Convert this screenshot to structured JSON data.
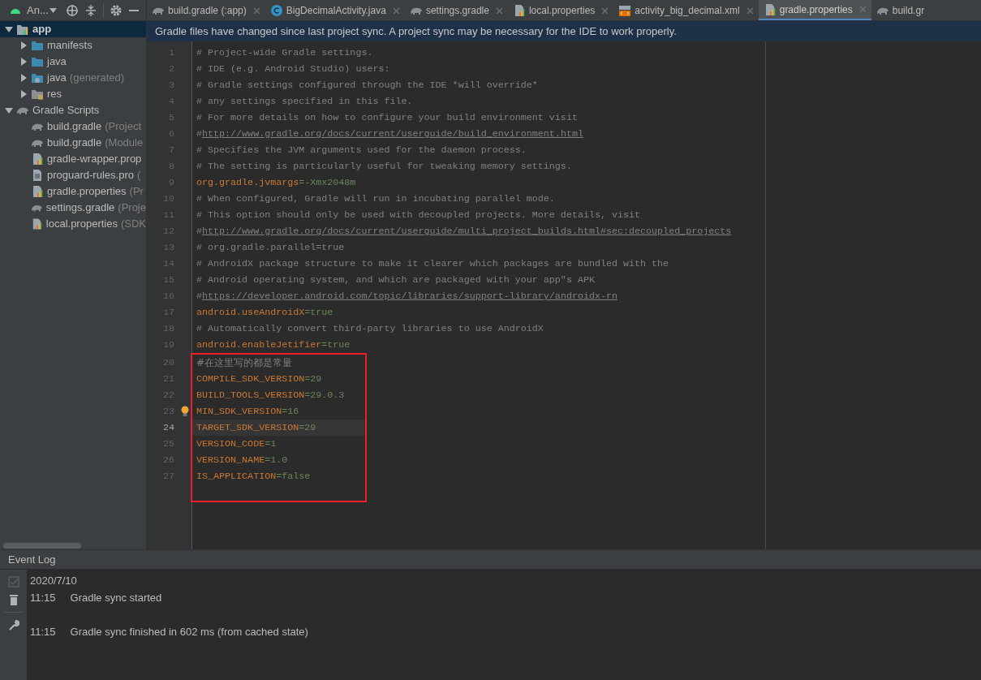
{
  "toolbar": {
    "project_view": "An..."
  },
  "tabs": [
    {
      "label": "build.gradle (:app)",
      "kind": "gradle",
      "selected": false,
      "closable": true
    },
    {
      "label": "BigDecimalActivity.java",
      "kind": "class",
      "selected": false,
      "closable": true
    },
    {
      "label": "settings.gradle",
      "kind": "gradle",
      "selected": false,
      "closable": true
    },
    {
      "label": "local.properties",
      "kind": "properties",
      "selected": false,
      "closable": true
    },
    {
      "label": "activity_big_decimal.xml",
      "kind": "xml",
      "selected": false,
      "closable": true
    },
    {
      "label": "gradle.properties",
      "kind": "properties",
      "selected": true,
      "closable": true
    },
    {
      "label": "build.gr",
      "kind": "gradle",
      "selected": false,
      "closable": false
    }
  ],
  "project_tree": [
    {
      "label": "app",
      "kind": "module",
      "expanded": true,
      "selected": true,
      "children": [
        {
          "label": "manifests",
          "kind": "folder",
          "expanded": false,
          "selected": false
        },
        {
          "label": "java",
          "kind": "folder",
          "expanded": false,
          "selected": false
        },
        {
          "label": "java",
          "note": "(generated)",
          "kind": "generated",
          "expanded": false,
          "selected": false
        },
        {
          "label": "res",
          "kind": "resources",
          "expanded": false,
          "selected": false
        }
      ]
    },
    {
      "label": "Gradle Scripts",
      "kind": "gradle",
      "expanded": true,
      "selected": false,
      "children": [
        {
          "label": "build.gradle",
          "note": "(Project",
          "kind": "gradle",
          "selected": false
        },
        {
          "label": "build.gradle",
          "note": "(Module",
          "kind": "gradle",
          "selected": false
        },
        {
          "label": "gradle-wrapper.prop",
          "kind": "properties",
          "selected": false
        },
        {
          "label": "proguard-rules.pro",
          "note": "(",
          "kind": "text",
          "selected": false
        },
        {
          "label": "gradle.properties",
          "note": "(Pr",
          "kind": "properties",
          "selected": false
        },
        {
          "label": "settings.gradle",
          "note": "(Proje",
          "kind": "gradle",
          "selected": false
        },
        {
          "label": "local.properties",
          "note": "(SDK",
          "kind": "properties",
          "selected": false
        }
      ]
    }
  ],
  "notification": "Gradle files have changed since last project sync. A project sync may be necessary for the IDE to work properly.",
  "editor": {
    "lines": [
      {
        "number": "1",
        "current": false,
        "parts": [
          {
            "kind": "comment",
            "text": "# Project-wide Gradle settings."
          }
        ]
      },
      {
        "number": "2",
        "current": false,
        "parts": [
          {
            "kind": "comment",
            "text": "# IDE (e.g. Android Studio) users:"
          }
        ]
      },
      {
        "number": "3",
        "current": false,
        "parts": [
          {
            "kind": "comment",
            "text": "# Gradle settings configured through the IDE *will override*"
          }
        ]
      },
      {
        "number": "4",
        "current": false,
        "parts": [
          {
            "kind": "comment",
            "text": "# any settings specified in this file."
          }
        ]
      },
      {
        "number": "5",
        "current": false,
        "parts": [
          {
            "kind": "comment",
            "text": "# For more details on how to configure your build environment visit"
          }
        ]
      },
      {
        "number": "6",
        "current": false,
        "parts": [
          {
            "kind": "comment",
            "text": "# "
          },
          {
            "kind": "link",
            "text": "http://www.gradle.org/docs/current/userguide/build_environment.html"
          }
        ]
      },
      {
        "number": "7",
        "current": false,
        "parts": [
          {
            "kind": "comment",
            "text": "# Specifies the JVM arguments used for the daemon process."
          }
        ]
      },
      {
        "number": "8",
        "current": false,
        "parts": [
          {
            "kind": "comment",
            "text": "# The setting is particularly useful for tweaking memory settings."
          }
        ]
      },
      {
        "number": "9",
        "current": false,
        "parts": [
          {
            "kind": "key",
            "text": "org.gradle.jvmargs"
          },
          {
            "kind": "value",
            "text": "=-Xmx2048m"
          }
        ]
      },
      {
        "number": "10",
        "current": false,
        "parts": [
          {
            "kind": "comment",
            "text": "# When configured, Gradle will run in incubating parallel mode."
          }
        ]
      },
      {
        "number": "11",
        "current": false,
        "parts": [
          {
            "kind": "comment",
            "text": "# This option should only be used with decoupled projects. More details, visit"
          }
        ]
      },
      {
        "number": "12",
        "current": false,
        "parts": [
          {
            "kind": "comment",
            "text": "# "
          },
          {
            "kind": "link",
            "text": "http://www.gradle.org/docs/current/userguide/multi_project_builds.html#sec:decoupled_projects"
          }
        ]
      },
      {
        "number": "13",
        "current": false,
        "parts": [
          {
            "kind": "comment",
            "text": "# org.gradle.parallel=true"
          }
        ]
      },
      {
        "number": "14",
        "current": false,
        "parts": [
          {
            "kind": "comment",
            "text": "# AndroidX package structure to make it clearer which packages are bundled with the"
          }
        ]
      },
      {
        "number": "15",
        "current": false,
        "parts": [
          {
            "kind": "comment",
            "text": "# Android operating system, and which are packaged with your app\"s APK"
          }
        ]
      },
      {
        "number": "16",
        "current": false,
        "parts": [
          {
            "kind": "comment",
            "text": "# "
          },
          {
            "kind": "link",
            "text": "https://developer.android.com/topic/libraries/support-library/androidx-rn"
          }
        ]
      },
      {
        "number": "17",
        "current": false,
        "parts": [
          {
            "kind": "key",
            "text": "android.useAndroidX"
          },
          {
            "kind": "value",
            "text": "=true"
          }
        ]
      },
      {
        "number": "18",
        "current": false,
        "parts": [
          {
            "kind": "comment",
            "text": "# Automatically convert third-party libraries to use AndroidX"
          }
        ]
      },
      {
        "number": "19",
        "current": false,
        "parts": [
          {
            "kind": "key",
            "text": "android.enableJetifier"
          },
          {
            "kind": "value",
            "text": "=true"
          }
        ]
      }
    ],
    "framed_lines": [
      {
        "number": "20",
        "current": false,
        "parts": [
          {
            "kind": "comment",
            "text": "#在这里写的都是常量"
          }
        ]
      },
      {
        "number": "21",
        "current": false,
        "parts": [
          {
            "kind": "key",
            "text": "COMPILE_SDK_VERSION"
          },
          {
            "kind": "value",
            "text": "=29"
          }
        ]
      },
      {
        "number": "22",
        "current": false,
        "parts": [
          {
            "kind": "key",
            "text": "BUILD_TOOLS_VERSION"
          },
          {
            "kind": "value",
            "text": "=29.0.3"
          }
        ]
      },
      {
        "number": "23",
        "current": false,
        "bulb": true,
        "parts": [
          {
            "kind": "key",
            "text": "MIN_SDK_VERSION"
          },
          {
            "kind": "value",
            "text": "=16"
          }
        ]
      },
      {
        "number": "24",
        "current": true,
        "parts": [
          {
            "kind": "key",
            "text": "TARGET_SDK_VERSION"
          },
          {
            "kind": "value",
            "text": "=29"
          }
        ]
      },
      {
        "number": "25",
        "current": false,
        "parts": [
          {
            "kind": "key",
            "text": "VERSION_CODE"
          },
          {
            "kind": "value",
            "text": "=1"
          }
        ]
      },
      {
        "number": "26",
        "current": false,
        "parts": [
          {
            "kind": "key",
            "text": "VERSION_NAME"
          },
          {
            "kind": "value",
            "text": "=1.0"
          }
        ]
      },
      {
        "number": "27",
        "current": false,
        "parts": [
          {
            "kind": "key",
            "text": "IS_APPLICATION"
          },
          {
            "kind": "value",
            "text": "=false"
          }
        ]
      }
    ]
  },
  "event_log": {
    "title": "Event Log",
    "date": "2020/7/10",
    "entries": [
      {
        "time": "11:15",
        "message": "Gradle sync started"
      },
      {
        "time": "11:15",
        "message": "Gradle sync finished in 602 ms (from cached state)"
      }
    ]
  }
}
